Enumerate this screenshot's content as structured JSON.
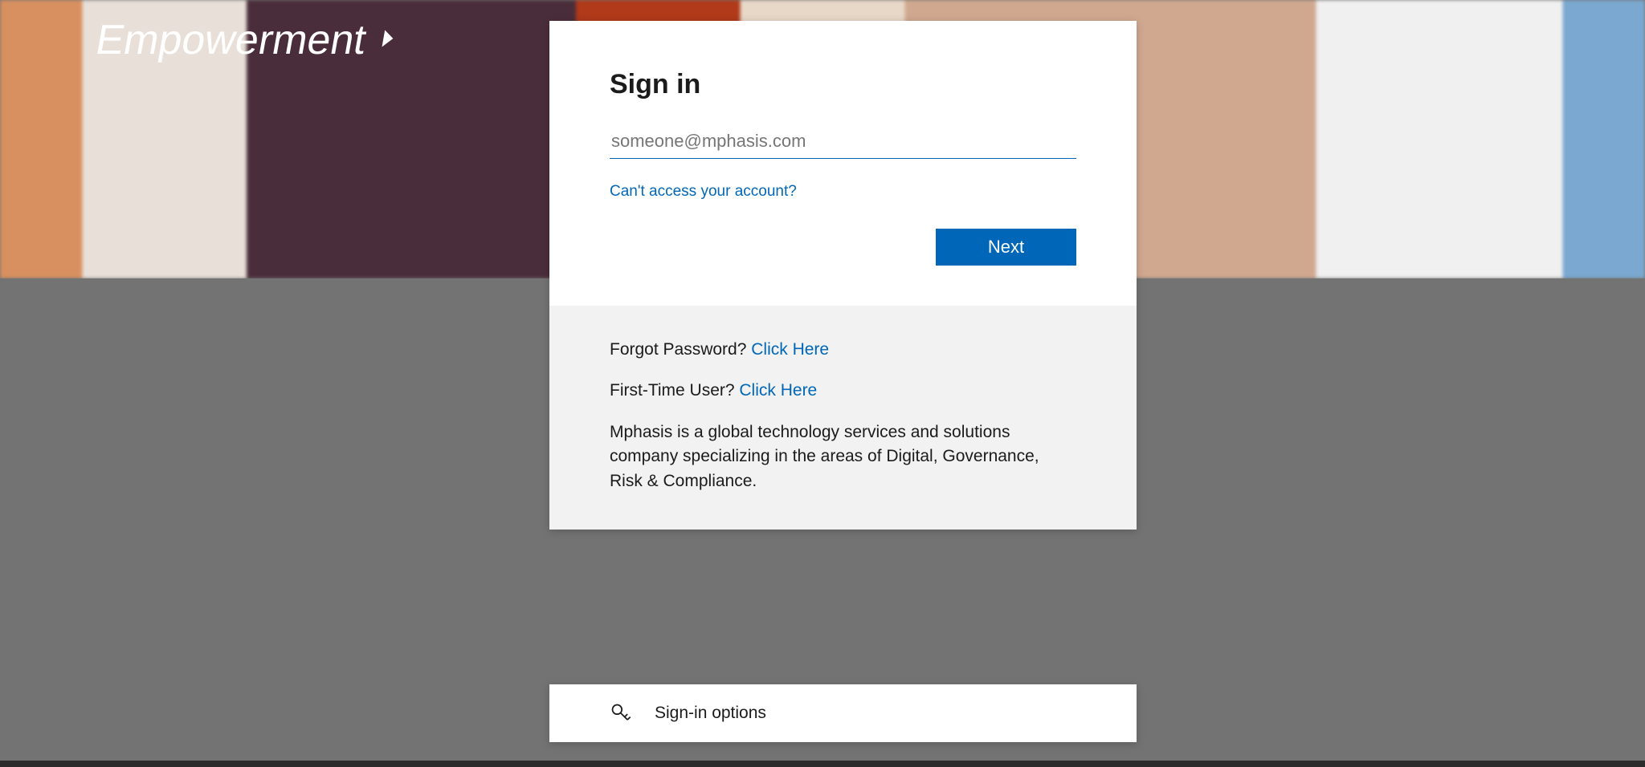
{
  "banner": {
    "text": "Empowerment"
  },
  "signin": {
    "title": "Sign in",
    "email_placeholder": "someone@mphasis.com",
    "email_value": "",
    "cant_access_label": "Can't access your account?",
    "next_button_label": "Next"
  },
  "info": {
    "forgot_password_label": "Forgot Password? ",
    "forgot_password_link": "Click Here",
    "first_time_label": "First-Time User? ",
    "first_time_link": "Click Here",
    "description": "Mphasis is a global technology services and solutions company specializing in the areas of Digital, Governance, Risk & Compliance."
  },
  "options": {
    "signin_options_label": "Sign-in options"
  }
}
